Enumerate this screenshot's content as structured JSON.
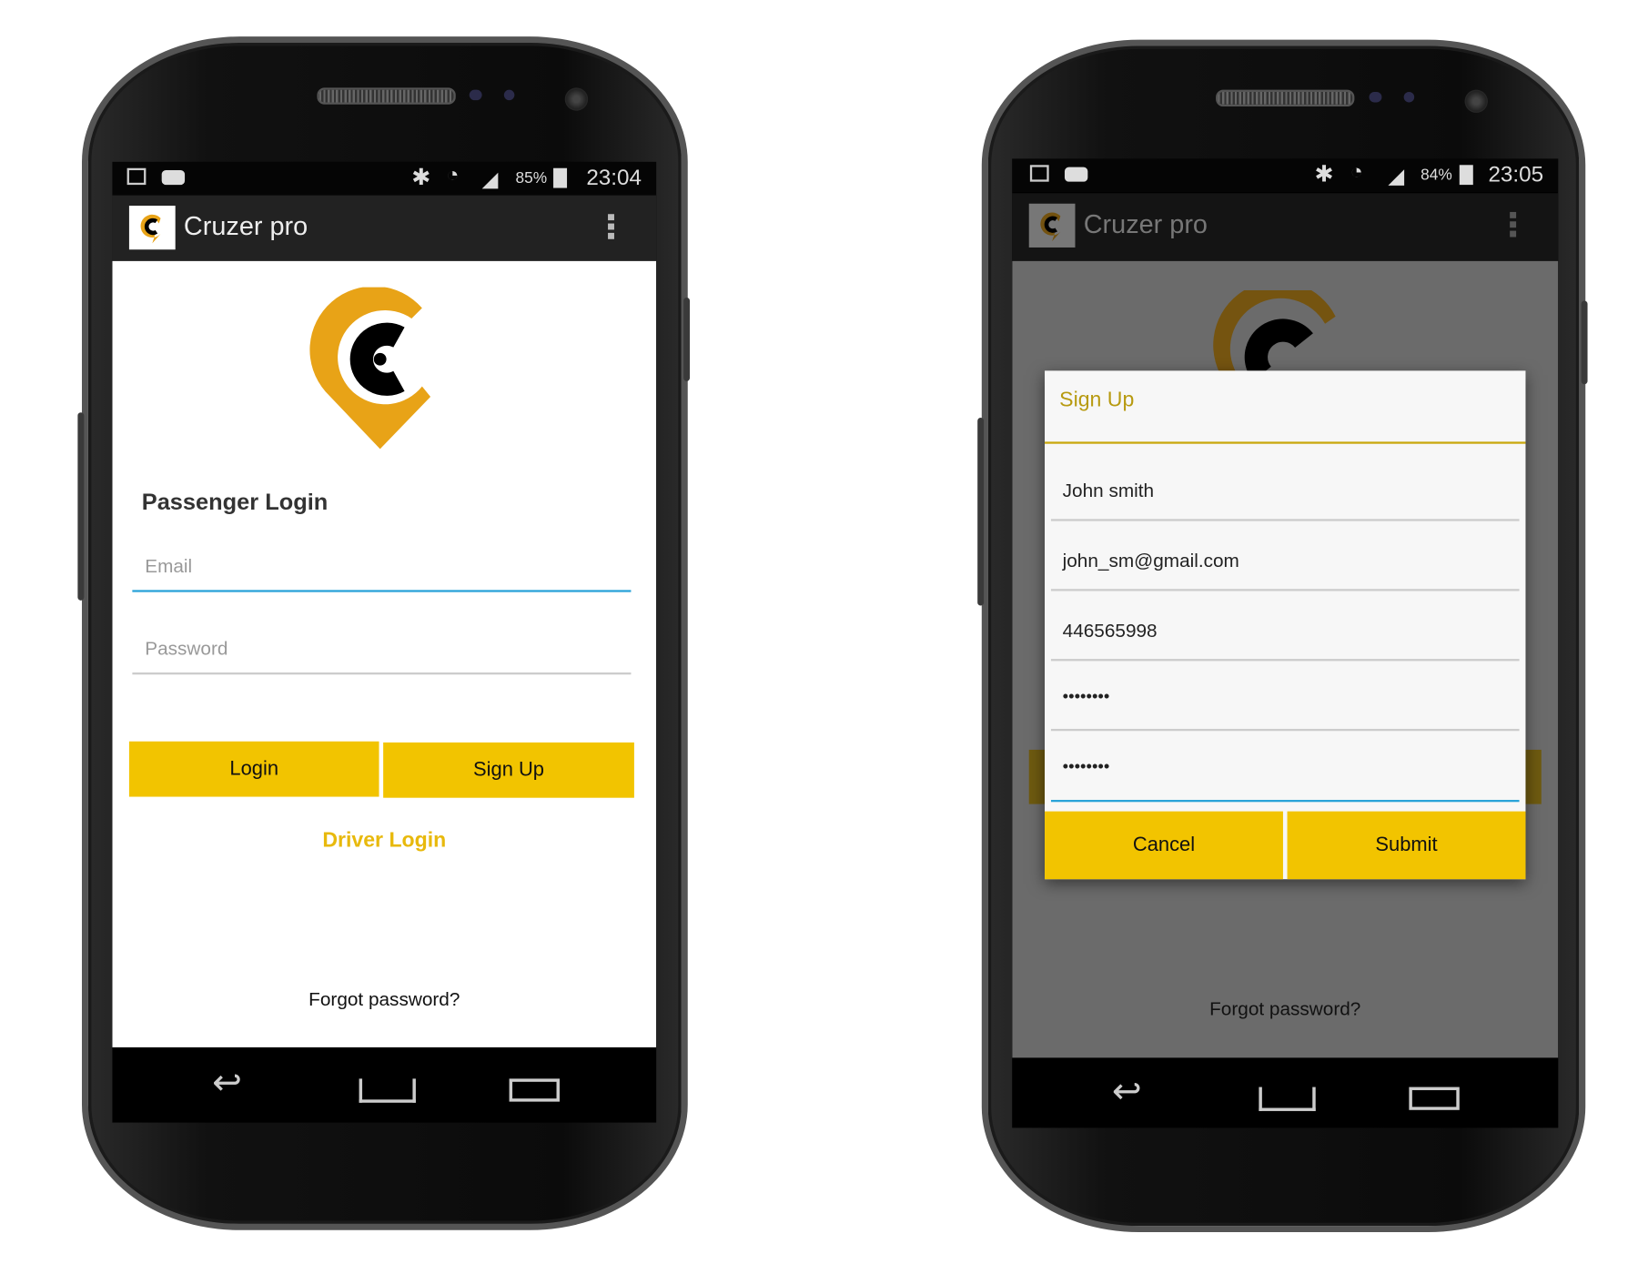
{
  "colors": {
    "accent": "#f2c400",
    "focus_underline": "#29a3d9",
    "driver_link": "#e8b90c",
    "dialog_title": "#b79a10"
  },
  "left_phone": {
    "status": {
      "icons": [
        "image-icon",
        "youtube-icon",
        "bluetooth-icon",
        "wifi-icon",
        "signal-icon",
        "battery-charging-icon"
      ],
      "battery": "85%",
      "time": "23:04"
    },
    "action_bar": {
      "app_name": "Cruzer pro"
    },
    "login": {
      "heading": "Passenger Login",
      "email_placeholder": "Email",
      "password_placeholder": "Password",
      "login_label": "Login",
      "signup_label": "Sign Up",
      "driver_login": "Driver Login",
      "forgot_password": "Forgot password?"
    }
  },
  "right_phone": {
    "status": {
      "icons": [
        "image-icon",
        "youtube-icon",
        "bluetooth-icon",
        "wifi-icon",
        "signal-icon",
        "battery-charging-icon"
      ],
      "battery": "84%",
      "time": "23:05"
    },
    "action_bar": {
      "app_name": "Cruzer pro"
    },
    "forgot_password": "Forgot password?",
    "dialog": {
      "title": "Sign Up",
      "fields": [
        {
          "name": "name",
          "value": "John smith"
        },
        {
          "name": "email",
          "value": "john_sm@gmail.com"
        },
        {
          "name": "phone",
          "value": "446565998"
        },
        {
          "name": "password",
          "value": "••••••••"
        },
        {
          "name": "confirm-password",
          "value": "••••••••"
        }
      ],
      "cancel_label": "Cancel",
      "submit_label": "Submit"
    }
  }
}
